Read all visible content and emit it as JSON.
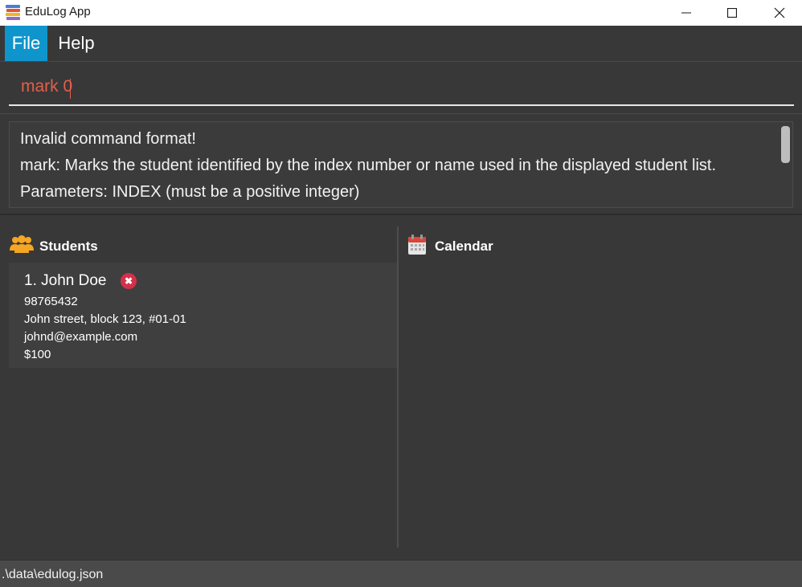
{
  "window": {
    "title": "EduLog App",
    "controls": [
      "minimize",
      "maximize",
      "close"
    ]
  },
  "menu": [
    {
      "label": "File",
      "active": true
    },
    {
      "label": "Help",
      "active": false
    }
  ],
  "command": {
    "value": "mark 0",
    "text_color": "#e35f4a"
  },
  "result": {
    "lines": [
      "Invalid command format!",
      "mark: Marks the student identified by the index number or name used in the displayed student list.",
      "Parameters: INDEX (must be a positive integer)"
    ]
  },
  "students_panel": {
    "title": "Students",
    "icon": "people-icon",
    "list": [
      {
        "name": "1. John Doe",
        "status_icon": "cross-circle-icon",
        "phone": "98765432",
        "address": "John street, block 123, #01-01",
        "email": "johnd@example.com",
        "fee": "$100"
      }
    ]
  },
  "calendar_panel": {
    "title": "Calendar",
    "icon": "calendar-icon"
  },
  "status_bar": {
    "path": ".\\data\\edulog.json"
  },
  "colors": {
    "background": "#383838",
    "accent": "#0f95cc",
    "error_text": "#e35f4a",
    "status_cross": "#d4304a",
    "people_icon": "#f5a623"
  }
}
